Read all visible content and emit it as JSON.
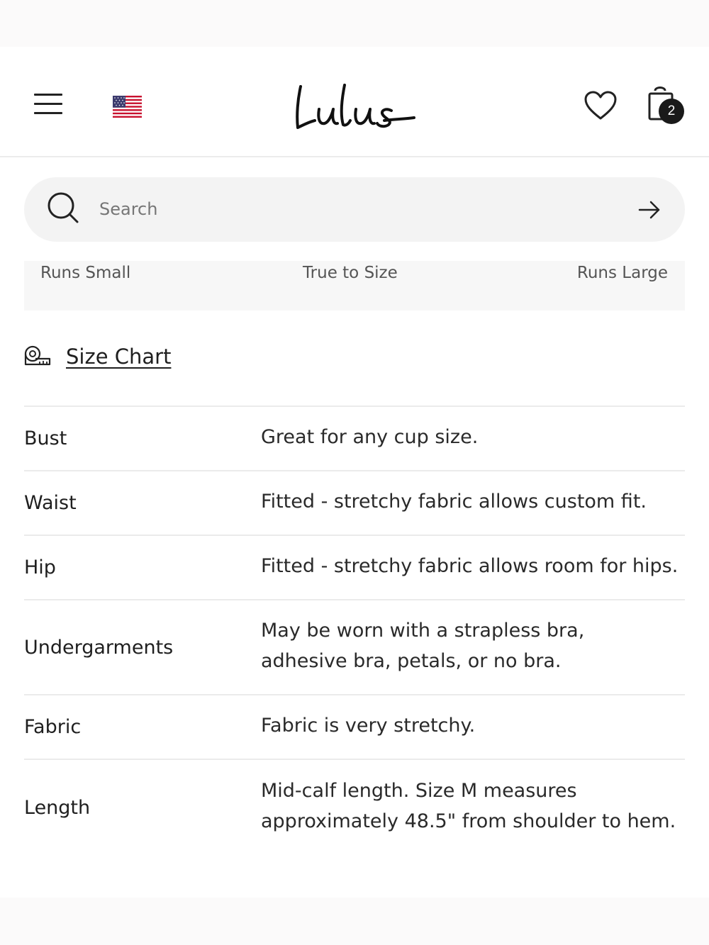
{
  "header": {
    "menu_icon": "hamburger-menu-icon",
    "region_flag": "us-flag-icon",
    "logo_text": "Lulus",
    "wishlist_icon": "heart-icon",
    "bag_icon": "shopping-bag-icon",
    "bag_count": "2"
  },
  "search": {
    "placeholder": "Search",
    "icon": "search-icon",
    "submit_icon": "arrow-right-icon"
  },
  "fit_scale": {
    "low": "Runs Small",
    "mid": "True to Size",
    "high": "Runs Large"
  },
  "size_chart": {
    "label": "Size Chart",
    "icon": "measuring-tape-icon"
  },
  "fit_details": [
    {
      "attribute": "Bust",
      "lines": [
        "Great for any cup size."
      ]
    },
    {
      "attribute": "Waist",
      "lines": [
        "Fitted - stretchy fabric allows custom fit."
      ]
    },
    {
      "attribute": "Hip",
      "lines": [
        "Fitted - stretchy fabric allows room for hips."
      ]
    },
    {
      "attribute": "Undergarments",
      "lines": [
        "May be worn with a strapless bra,",
        "adhesive bra, petals, or no bra."
      ]
    },
    {
      "attribute": "Fabric",
      "lines": [
        "Fabric is very stretchy."
      ]
    },
    {
      "attribute": "Length",
      "lines": [
        "Mid-calf length. Size M measures",
        "approximately 48.5\" from shoulder to hem."
      ]
    }
  ],
  "colors": {
    "text": "#1f1f1f",
    "muted": "#555555",
    "search_bg": "#f3f3f3",
    "badge_bg": "#1a1a1a",
    "divider": "#ebebeb"
  }
}
